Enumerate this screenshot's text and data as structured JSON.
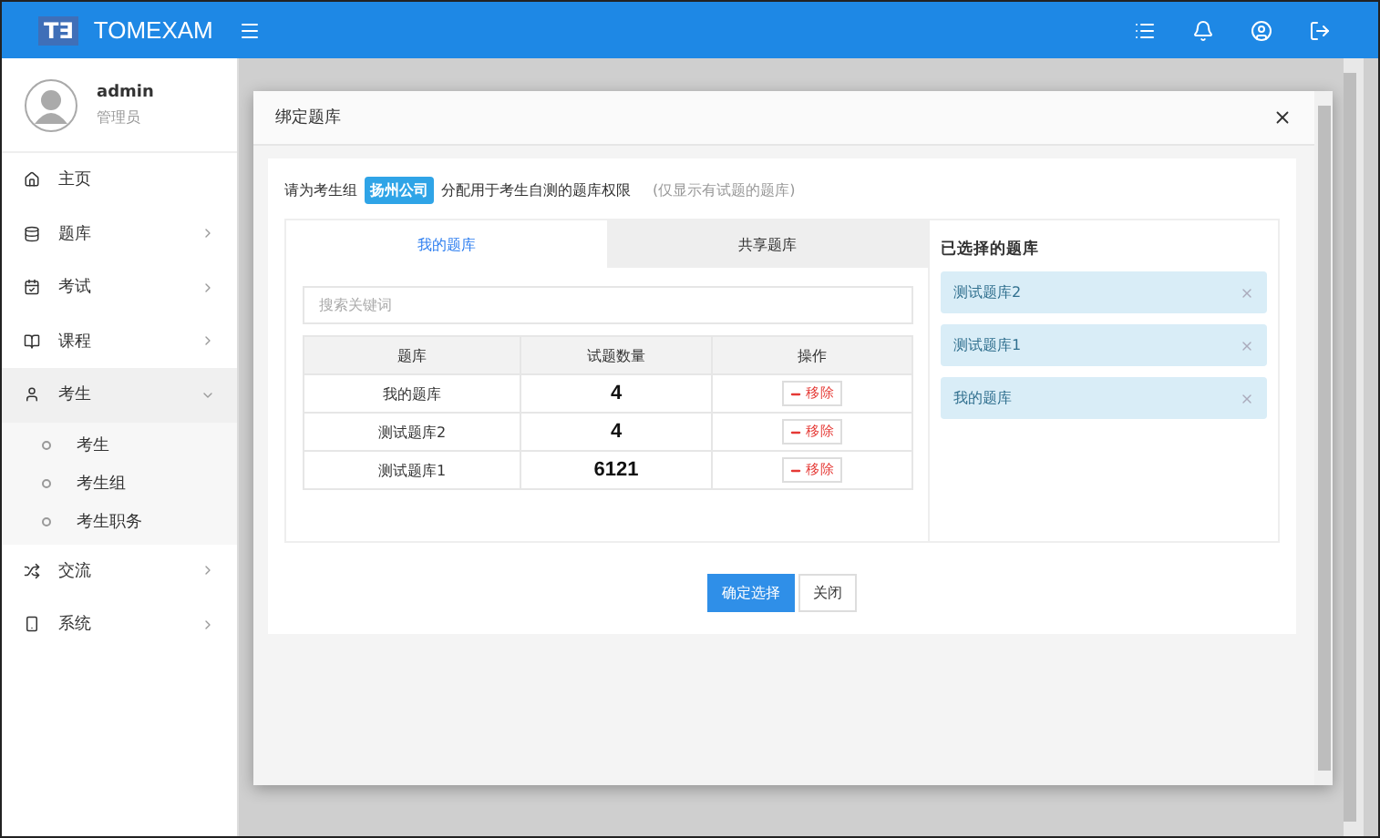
{
  "header": {
    "logo": "T∃",
    "brand": "TOMEXAM"
  },
  "user": {
    "name": "admin",
    "role": "管理员"
  },
  "sidebar": {
    "items": [
      {
        "label": "主页",
        "expanded": false,
        "has_children": false
      },
      {
        "label": "题库",
        "expanded": false,
        "has_children": true
      },
      {
        "label": "考试",
        "expanded": false,
        "has_children": true
      },
      {
        "label": "课程",
        "expanded": false,
        "has_children": true
      },
      {
        "label": "考生",
        "expanded": true,
        "has_children": true,
        "children": [
          {
            "label": "考生"
          },
          {
            "label": "考生组"
          },
          {
            "label": "考生职务"
          }
        ]
      },
      {
        "label": "交流",
        "expanded": false,
        "has_children": true
      },
      {
        "label": "系统",
        "expanded": false,
        "has_children": true
      }
    ]
  },
  "dialog": {
    "title": "绑定题库",
    "intro": {
      "before": "请为考生组",
      "group": "扬州公司",
      "after": "分配用于考生自测的题库权限",
      "hint": "(仅显示有试题的题库)"
    },
    "tabs": [
      {
        "label": "我的题库",
        "selected": true
      },
      {
        "label": "共享题库",
        "selected": false
      }
    ],
    "search": {
      "placeholder": "搜索关键词"
    },
    "table": {
      "columns": [
        "题库",
        "试题数量",
        "操作"
      ],
      "rows": [
        {
          "name": "我的题库",
          "count": "4",
          "action": "移除"
        },
        {
          "name": "测试题库2",
          "count": "4",
          "action": "移除"
        },
        {
          "name": "测试题库1",
          "count": "6121",
          "action": "移除"
        }
      ]
    },
    "selected_title": "已选择的题库",
    "selected": [
      "测试题库2",
      "测试题库1",
      "我的题库"
    ],
    "buttons": [
      {
        "label": "确定选择",
        "kind": "primary"
      },
      {
        "label": "关闭",
        "kind": "default"
      }
    ]
  }
}
